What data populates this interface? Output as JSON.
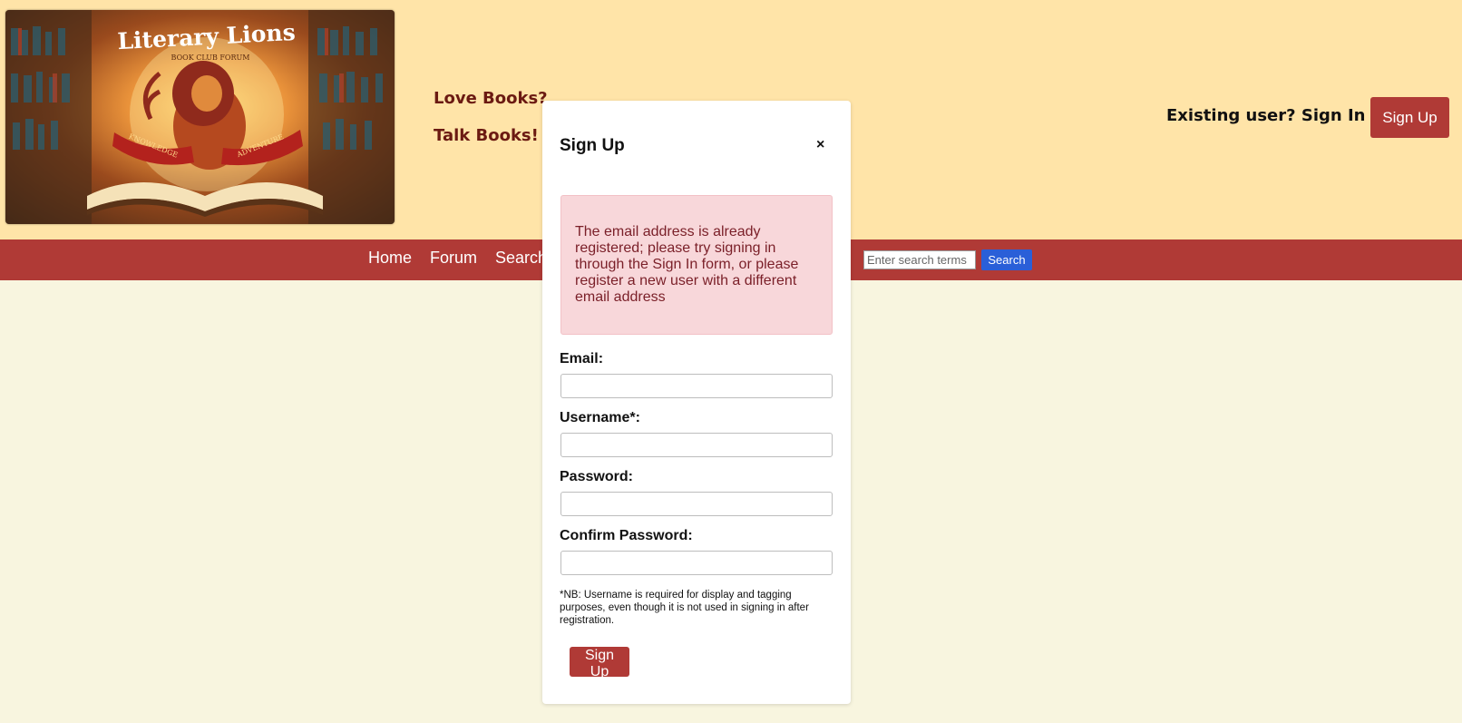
{
  "header": {
    "logo": {
      "title_text": "Literary Lions",
      "subtitle_text": "BOOK CLUB FORUM",
      "ribbon_left": "KNOWLEDGE",
      "ribbon_right": "ADVENTURE"
    },
    "taglines": [
      "Love Books?",
      "Talk Books!"
    ],
    "signin_toggle": "Existing user? Sign In ▼",
    "signup_button": "Sign Up"
  },
  "navbar": {
    "items": [
      "Home",
      "Forum",
      "Search"
    ],
    "search": {
      "placeholder": "Enter search terms",
      "value": "",
      "button_label": "Search"
    }
  },
  "modal": {
    "title": "Sign Up",
    "close": "×",
    "error_message": "The email address is already registered; please try signing in through the Sign In form, or please register a new user with a different email address",
    "fields": [
      {
        "label": "Email:",
        "value": ""
      },
      {
        "label": "Username*:",
        "value": ""
      },
      {
        "label": "Password:",
        "value": ""
      },
      {
        "label": "Confirm Password:",
        "value": ""
      }
    ],
    "note": "*NB: Username is required for display and tagging purposes, even though it is not used in signing in after registration.",
    "submit_label": "Sign Up"
  },
  "colors": {
    "header_bg": "#ffe4a8",
    "page_bg": "#f8f5df",
    "brand_red": "#b03a36",
    "search_blue": "#2a5fd8",
    "alert_bg": "#f8d7da",
    "tagline_text": "#6b1a12"
  }
}
